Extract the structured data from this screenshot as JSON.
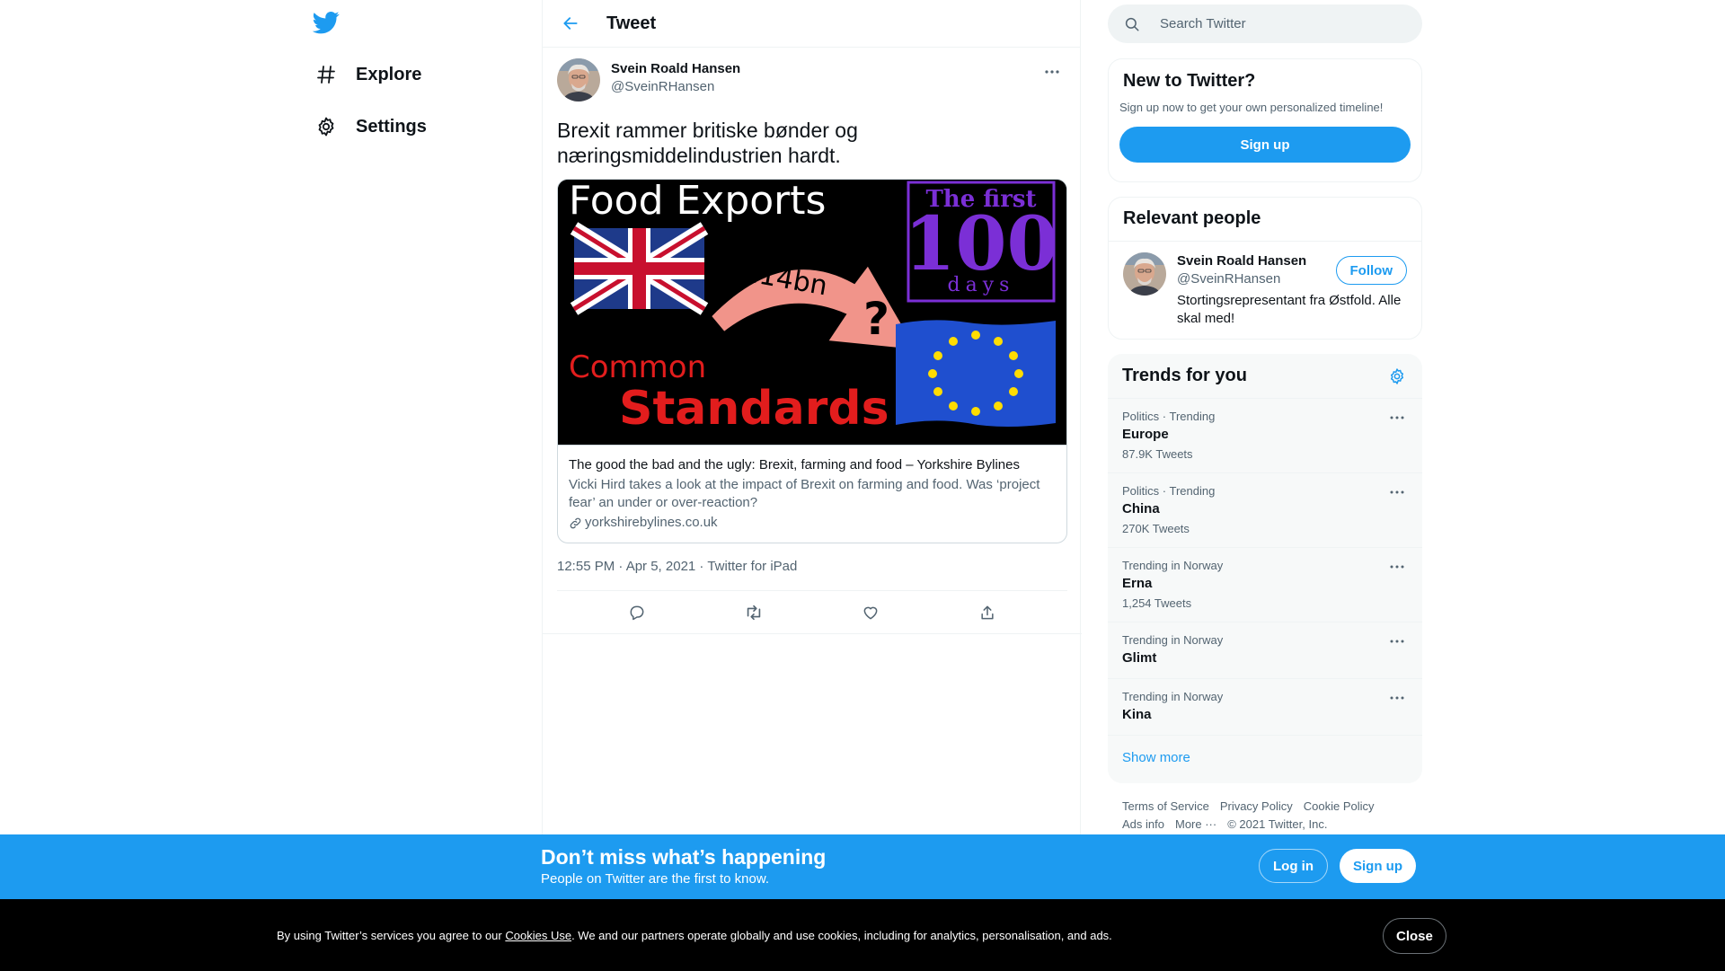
{
  "nav": {
    "items": [
      {
        "label": "Explore",
        "icon": "hashtag-icon"
      },
      {
        "label": "Settings",
        "icon": "gear-icon"
      }
    ]
  },
  "header": {
    "title": "Tweet"
  },
  "tweet": {
    "display_name": "Svein Roald Hansen",
    "handle": "@SveinRHansen",
    "text": "Brexit rammer britiske bønder og næringsmiddelindustrien hardt.",
    "card": {
      "image_title": "Food Exports",
      "image_badge_line1": "The first",
      "image_badge_number": "100",
      "image_badge_line2": "days",
      "image_amount": "£14bn",
      "image_question": "?",
      "image_line1": "Common",
      "image_line2": "Standards",
      "title": "The good the bad and the ugly: Brexit, farming and food – Yorkshire Bylines",
      "description": "Vicki Hird takes a look at the impact of Brexit on farming and food. Was ‘project fear’ an under or over-reaction?",
      "domain": "yorkshirebylines.co.uk"
    },
    "meta": "12:55 PM · Apr 5, 2021 · Twitter for iPad"
  },
  "search": {
    "placeholder": "Search Twitter"
  },
  "new_to_twitter": {
    "title": "New to Twitter?",
    "subtitle": "Sign up now to get your own personalized timeline!",
    "button": "Sign up"
  },
  "relevant": {
    "title": "Relevant people",
    "name": "Svein Roald Hansen",
    "handle": "@SveinRHansen",
    "bio": "Stortingsrepresentant fra Østfold. Alle skal med!",
    "follow": "Follow"
  },
  "trends": {
    "title": "Trends for you",
    "items": [
      {
        "context": "Politics · Trending",
        "name": "Europe",
        "count": "87.9K Tweets"
      },
      {
        "context": "Politics · Trending",
        "name": "China",
        "count": "270K Tweets"
      },
      {
        "context": "Trending in Norway",
        "name": "Erna",
        "count": "1,254 Tweets"
      },
      {
        "context": "Trending in Norway",
        "name": "Glimt",
        "count": ""
      },
      {
        "context": "Trending in Norway",
        "name": "Kina",
        "count": ""
      }
    ],
    "show_more": "Show more"
  },
  "footer": {
    "links": [
      "Terms of Service",
      "Privacy Policy",
      "Cookie Policy",
      "Ads info",
      "More ···"
    ],
    "copyright": "© 2021 Twitter, Inc."
  },
  "banner": {
    "title": "Don’t miss what’s happening",
    "subtitle": "People on Twitter are the first to know.",
    "login": "Log in",
    "signup": "Sign up"
  },
  "cookie": {
    "text_before": "By using Twitter’s services you agree to our ",
    "link": "Cookies Use",
    "text_after": ". We and our partners operate globally and use cookies, including for analytics, personalisation, and ads.",
    "close": "Close"
  },
  "colors": {
    "accent": "#1d9bf0",
    "text": "#0f1419",
    "secondary": "#536471"
  }
}
